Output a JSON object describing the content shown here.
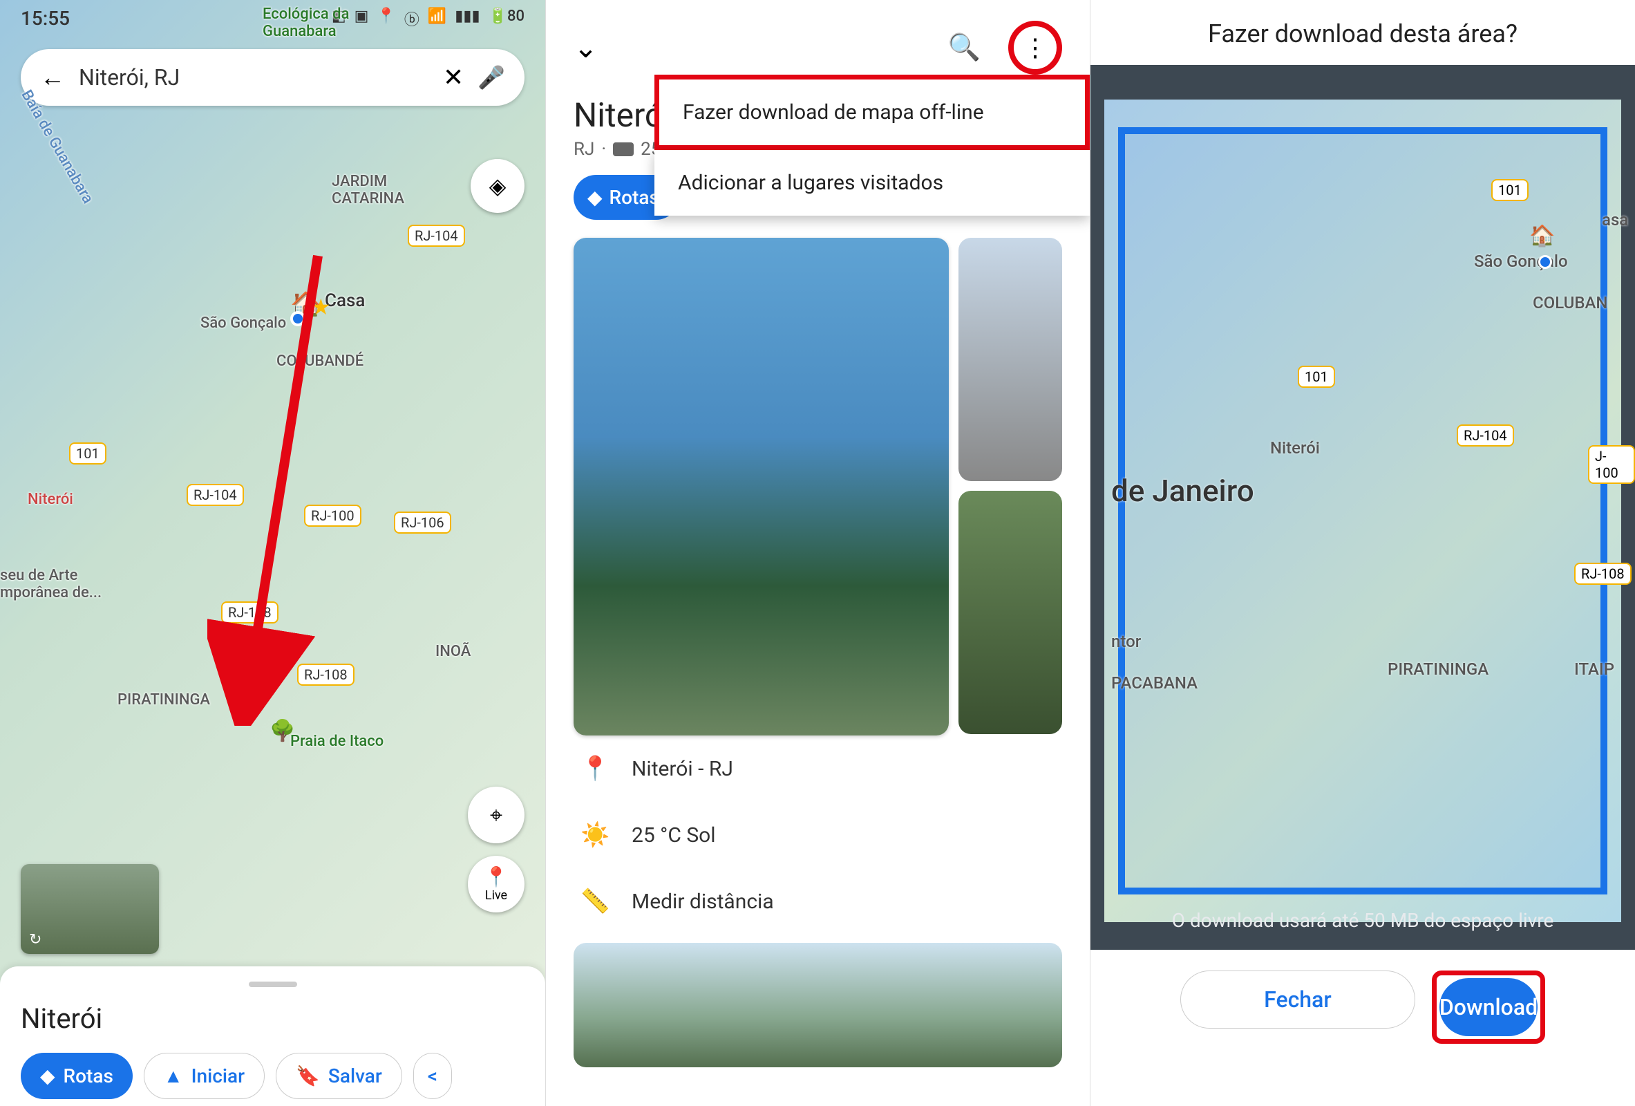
{
  "panel1": {
    "status_time": "15:55",
    "status_battery": "80",
    "search_value": "Niterói, RJ",
    "map_labels": {
      "jardim": "JARDIM\nCATARINA",
      "casa": "Casa",
      "sao_goncalo": "São Gonçalo",
      "colubande": "COLUBANDÉ",
      "niteroi": "Niterói",
      "museu": "seu de Arte\nmporânea de...",
      "piratininga": "PIRATININGA",
      "inoa": "INOÃ",
      "praia": "Praia de Itaco",
      "guanabara": "Baía de Guanabara",
      "ecologica": "Ecológica da\nGuanabara"
    },
    "roads": {
      "r101": "101",
      "r104a": "RJ-104",
      "r104b": "RJ-104",
      "r100": "RJ-100",
      "r106": "RJ-106",
      "r108a": "RJ-108",
      "r108b": "RJ-108"
    },
    "live_label": "Live",
    "sheet_title": "Niterói",
    "chips": {
      "rotas": "Rotas",
      "iniciar": "Iniciar",
      "salvar": "Salvar"
    }
  },
  "panel2": {
    "title": "Niterói",
    "subtitle_state": "RJ",
    "subtitle_dist": "25 m",
    "dropdown": {
      "download": "Fazer download de mapa off-line",
      "visited": "Adicionar a lugares visitados"
    },
    "routes": "Rotas",
    "location": "Niterói - RJ",
    "weather": "25 °C Sol",
    "measure": "Medir distância"
  },
  "panel3": {
    "title": "Fazer download desta área?",
    "map_labels": {
      "sao_goncalo": "São Gonçalo",
      "colubande": "COLUBAN",
      "niteroi": "Niterói",
      "rio": "de Janeiro",
      "piratininga": "PIRATININGA",
      "itaipu": "ITAIP",
      "copacabana": "PACABANA",
      "ntor": "ntor",
      "asa": "asa"
    },
    "roads": {
      "r101a": "101",
      "r101b": "101",
      "r104a": "RJ-104",
      "r100": "J-100",
      "r108": "RJ-108"
    },
    "note": "O download usará até 50 MB do espaço livre",
    "close": "Fechar",
    "download": "Download"
  }
}
